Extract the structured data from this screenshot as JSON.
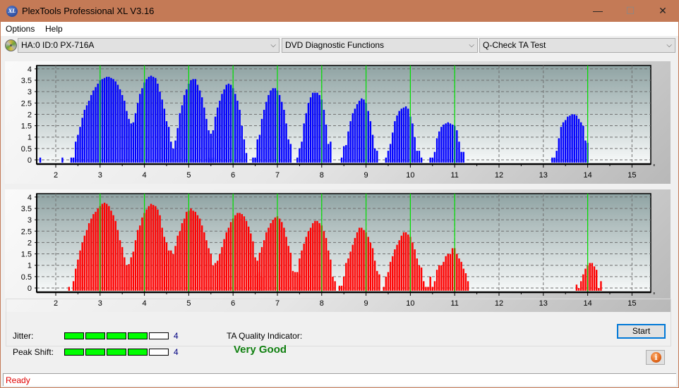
{
  "window": {
    "title": "PlexTools Professional XL V3.16",
    "logo_text": "XL",
    "minimize": "—",
    "maximize": "☐",
    "close": "✕"
  },
  "menu": {
    "items": [
      "Options",
      "Help"
    ]
  },
  "toolbar": {
    "drive": "HA:0 ID:0  PX-716A",
    "function": "DVD Diagnostic Functions",
    "test": "Q-Check TA Test",
    "arrow": "⌵"
  },
  "chart_data": [
    {
      "type": "bar",
      "name": "Land distribution",
      "color": "#0000ff",
      "x_range": [
        1.6,
        15.4
      ],
      "ylim": [
        -0.15,
        4.1
      ],
      "xticks": [
        2,
        3,
        4,
        5,
        6,
        7,
        8,
        9,
        10,
        11,
        12,
        13,
        14,
        15
      ],
      "yticks": [
        "0",
        "0.5",
        "1",
        "1.5",
        "2",
        "2.5",
        "3",
        "3.5",
        "4"
      ],
      "reference_lines": [
        3,
        4,
        5,
        6,
        7,
        8,
        9,
        10,
        11,
        14
      ],
      "grid": true,
      "bar_step": 0.05,
      "clusters": [
        {
          "start": 1.65,
          "values": [
            0.1
          ]
        },
        {
          "start": 2.15,
          "values": [
            0.1
          ]
        },
        {
          "start": 2.35,
          "values": [
            0.1,
            0.1,
            0.8,
            1.1,
            1.45,
            1.85,
            2.2,
            2.4,
            2.6,
            2.85,
            3.05,
            3.2,
            3.35,
            3.5,
            3.55,
            3.6,
            3.65,
            3.65,
            3.6,
            3.55,
            3.45,
            3.3,
            3.1,
            2.85,
            2.6,
            2.15,
            1.8,
            1.6,
            1.65,
            2.05,
            2.5,
            2.9,
            3.15,
            3.4,
            3.55,
            3.65,
            3.7,
            3.65,
            3.6,
            3.35,
            3.0,
            2.65,
            2.25,
            1.7,
            1.45,
            0.8,
            0.5,
            0.85,
            1.4,
            2.05,
            2.4,
            2.85,
            3.1,
            3.35,
            3.5,
            3.55,
            3.55,
            3.3,
            3.05,
            2.75,
            2.3,
            1.8,
            1.3,
            0.5,
            0.1
          ]
        },
        {
          "start": 5.45,
          "values": [
            0.1,
            1.15,
            1.3,
            1.9,
            2.3,
            2.6,
            2.9,
            3.1,
            3.3,
            3.35,
            3.3,
            3.15,
            2.9,
            2.6,
            2.2,
            1.5,
            0.9,
            0.3
          ]
        },
        {
          "start": 6.45,
          "values": [
            0.1,
            0.1,
            0.9,
            1.1,
            1.8,
            2.2,
            2.55,
            2.85,
            3.05,
            3.15,
            3.15,
            3.05,
            2.85,
            2.55,
            2.2,
            1.6,
            0.9,
            0.7
          ]
        },
        {
          "start": 7.45,
          "values": [
            0.1,
            0.5,
            0.8,
            1.6,
            2.05,
            2.5,
            2.75,
            2.95,
            2.95,
            2.95,
            2.85,
            2.65,
            2.2,
            1.55,
            0.7,
            0.8
          ]
        },
        {
          "start": 8.45,
          "values": [
            0.1,
            0.6,
            0.65,
            1.25,
            1.7,
            2.05,
            2.25,
            2.45,
            2.6,
            2.7,
            2.65,
            2.5,
            2.15,
            1.7,
            1.1,
            0.5,
            0.4
          ]
        },
        {
          "start": 9.45,
          "values": [
            0.1,
            0.4,
            0.7,
            1.2,
            1.7,
            1.95,
            2.15,
            2.25,
            2.3,
            2.35,
            2.25,
            1.9,
            1.6,
            1.0,
            0.4,
            0.4,
            0.1
          ]
        },
        {
          "start": 10.45,
          "values": [
            0.1,
            0.1,
            0.35,
            0.95,
            1.25,
            1.45,
            1.55,
            1.6,
            1.65,
            1.6,
            1.55,
            1.5,
            1.3,
            0.8,
            0.35,
            0.35
          ]
        },
        {
          "start": 13.2,
          "values": [
            0.1,
            0.1,
            0.4,
            0.95,
            1.45,
            1.65,
            1.75,
            1.9,
            1.95,
            2.0,
            2.0,
            1.95,
            1.8,
            1.65,
            1.5,
            0.85,
            0.75
          ]
        }
      ],
      "axis_ticks_note": "x in bit lengths (T), y in relative count"
    },
    {
      "type": "bar",
      "name": "Pit distribution",
      "color": "#ff0000",
      "x_range": [
        1.6,
        15.4
      ],
      "ylim": [
        -0.15,
        4.1
      ],
      "xticks": [
        2,
        3,
        4,
        5,
        6,
        7,
        8,
        9,
        10,
        11,
        12,
        13,
        14,
        15
      ],
      "yticks": [
        "0",
        "0.5",
        "1",
        "1.5",
        "2",
        "2.5",
        "3",
        "3.5",
        "4"
      ],
      "reference_lines": [
        3,
        4,
        5,
        6,
        7,
        8,
        9,
        10,
        11,
        14
      ],
      "grid": true,
      "bar_step": 0.05,
      "clusters": [
        {
          "start": 2.3,
          "values": [
            0.05
          ]
        },
        {
          "start": 2.4,
          "values": [
            0.3,
            0.85,
            1.25,
            1.65,
            2.0,
            2.3,
            2.55,
            2.85,
            3.05,
            3.25,
            3.35,
            3.5,
            3.6,
            3.7,
            3.75,
            3.7,
            3.6,
            3.4,
            3.2,
            2.95,
            2.55,
            2.1,
            1.8,
            1.35,
            1.0,
            1.05,
            1.35,
            1.6,
            2.1,
            2.55,
            2.75,
            3.1,
            3.3,
            3.45,
            3.6,
            3.7,
            3.65,
            3.6,
            3.45,
            3.2,
            2.65,
            2.25,
            2.0,
            1.65,
            1.65,
            1.5,
            1.85,
            2.3,
            2.5,
            2.85,
            3.05,
            3.35,
            3.4,
            3.5,
            3.4,
            3.35,
            3.2,
            3.05,
            2.75,
            2.45,
            2.1,
            1.75,
            1.5,
            1.0,
            1.1,
            1.2,
            1.5,
            1.8,
            2.15,
            2.45,
            2.65,
            2.9,
            3.05,
            3.2,
            3.3,
            3.3,
            3.25,
            3.15,
            2.95,
            2.7,
            2.4,
            2.05,
            1.35,
            0.6,
            0.7,
            0.5
          ]
        },
        {
          "start": 6.55,
          "values": [
            1.2,
            1.55,
            1.8,
            2.1,
            2.45,
            2.65,
            2.85,
            3.0,
            3.1,
            3.15,
            3.05,
            2.9,
            2.65,
            2.25,
            1.85,
            1.55,
            0.75,
            0.7,
            0.7,
            0.6
          ]
        },
        {
          "start": 7.5,
          "values": [
            1.3,
            1.65,
            1.95,
            2.25,
            2.5,
            2.65,
            2.85,
            2.95,
            2.95,
            2.85,
            2.75,
            2.5,
            2.2,
            1.65,
            1.25,
            0.5,
            0.3
          ]
        },
        {
          "start": 8.4,
          "values": [
            0.1,
            0.1,
            0.5,
            1.1,
            1.3,
            1.6,
            1.9,
            2.2,
            2.45,
            2.65,
            2.65,
            2.55,
            2.45,
            2.25,
            2.0,
            1.75,
            1.2,
            0.75,
            0.6
          ]
        },
        {
          "start": 9.4,
          "values": [
            0.05,
            0.5,
            0.7,
            1.15,
            1.4,
            1.7,
            1.9,
            2.1,
            2.3,
            2.45,
            2.45,
            2.35,
            2.25,
            2.0,
            1.7,
            1.3,
            1.0,
            0.9
          ]
        },
        {
          "start": 10.3,
          "values": [
            0.3,
            0.05,
            0.05,
            0.5,
            0.05,
            0.3,
            0.8,
            1.0,
            1.0,
            1.15,
            1.4,
            1.5,
            1.5,
            1.75,
            1.75,
            1.5,
            1.3,
            1.15,
            0.85,
            0.65,
            0.3
          ]
        },
        {
          "start": 13.75,
          "values": [
            0.15,
            0.0,
            0.3,
            0.6,
            0.85,
            1.0,
            1.1,
            1.1,
            0.95,
            0.8,
            0.0,
            0.3
          ]
        }
      ]
    }
  ],
  "bottom": {
    "jitter_label": "Jitter:",
    "jitter_value": "4",
    "jitter_level": 4,
    "peak_shift_label": "Peak Shift:",
    "peak_shift_value": "4",
    "peak_shift_level": 4,
    "meter_segments": 5,
    "ta_quality_label": "TA Quality Indicator:",
    "ta_quality_value": "Very Good",
    "start_button": "Start",
    "info_button": "i"
  },
  "status": {
    "text": "Ready"
  }
}
